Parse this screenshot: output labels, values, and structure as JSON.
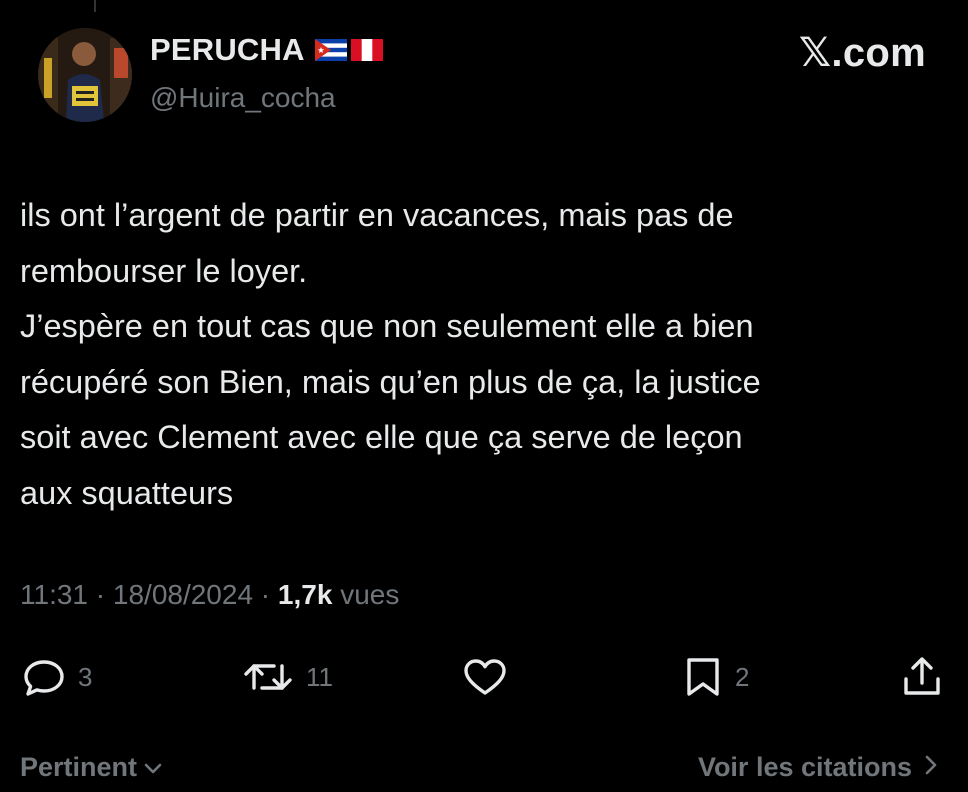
{
  "author": {
    "display_name": "PERUCHA",
    "handle": "@Huira_cocha",
    "flags": [
      "cuba-flag-icon",
      "peru-flag-icon"
    ]
  },
  "brand": {
    "logo_text": "𝕏.com"
  },
  "tweet": {
    "text": "ils ont l’argent de partir en vacances, mais pas de\nrembourser le loyer.\nJ’espère en tout cas que non seulement elle a bien\nrécupéré son Bien, mais qu’en plus de ça, la justice\nsoit avec Clement avec elle que ça serve de leçon\naux squatteurs"
  },
  "meta": {
    "time": "11:31",
    "separator": " · ",
    "date": "18/08/2024",
    "views_count": "1,7k",
    "views_label": " vues"
  },
  "actions": {
    "replies": "3",
    "reposts": "11",
    "bookmarks": "2"
  },
  "footer": {
    "sort_label": "Pertinent",
    "quotes_label": "Voir les citations"
  },
  "colors": {
    "background": "#000000",
    "text": "#e7e9ea",
    "muted": "#71767b"
  }
}
